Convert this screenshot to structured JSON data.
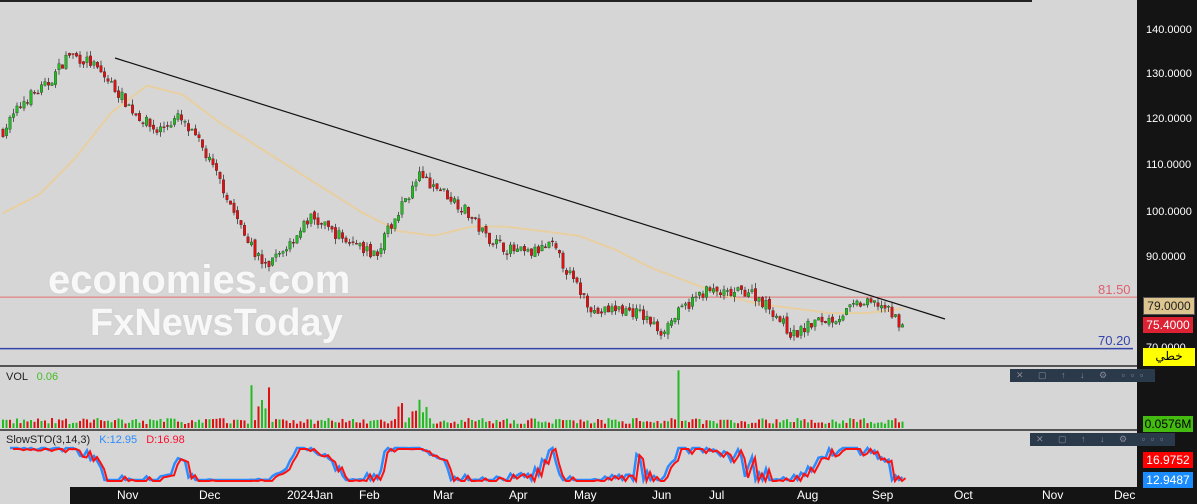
{
  "watermark": {
    "line1": "economies.com",
    "line2": "FxNewsToday"
  },
  "price_axis": {
    "ticks": [
      "140.0000",
      "130.0000",
      "120.0000",
      "110.0000",
      "100.0000",
      "90.0000",
      "70.0000"
    ],
    "ma_tag": "79.0000",
    "last_tag": "75.4000",
    "line_tag": "خطي"
  },
  "levels": {
    "resistance": "81.50",
    "support": "70.20"
  },
  "vol": {
    "title": "VOL",
    "value": "0.06",
    "tag": "0.0576M"
  },
  "sto": {
    "title": "SlowSTO(3,14,3)",
    "k": "K:12.95",
    "d": "D:16.98",
    "d_tag": "16.9752",
    "k_tag": "12.9487"
  },
  "toolbar": {
    "icons": "✕ ▢ ↑ ↓ ⚙ ▫▫▫"
  },
  "time_axis": [
    "Nov",
    "Dec",
    "2024Jan",
    "Feb",
    "Mar",
    "Apr",
    "May",
    "Jun",
    "Jul",
    "Aug",
    "Sep",
    "Oct",
    "Nov",
    "Dec"
  ],
  "chart_data": {
    "type": "candlestick",
    "ylim": [
      70,
      140
    ],
    "price_path": [
      118,
      125,
      128,
      135,
      133,
      128,
      122,
      118,
      121,
      115,
      106,
      95,
      88,
      93,
      99,
      96,
      93,
      91,
      100,
      108,
      105,
      101,
      95,
      92,
      91,
      93,
      85,
      78,
      79,
      78,
      74,
      79,
      83,
      82,
      83,
      79,
      73,
      76,
      77,
      80,
      80,
      75.4
    ],
    "ma_path": [
      100,
      104,
      112,
      122,
      128,
      126,
      120,
      115,
      110,
      105,
      100,
      96,
      95,
      97,
      97,
      96,
      95,
      92,
      88,
      85,
      82,
      80,
      79,
      78,
      78,
      79
    ],
    "trendline": [
      [
        134,
        "Oct"
      ],
      [
        79,
        "Sep"
      ]
    ],
    "hlines": [
      81.5,
      70.2
    ],
    "colors": {
      "up": "#22bb22",
      "down": "#dd1111",
      "ma": "#e8cfa0",
      "k": "#2a8cff",
      "d": "#ff1010",
      "res": "#e87070",
      "sup": "#3344aa"
    }
  }
}
